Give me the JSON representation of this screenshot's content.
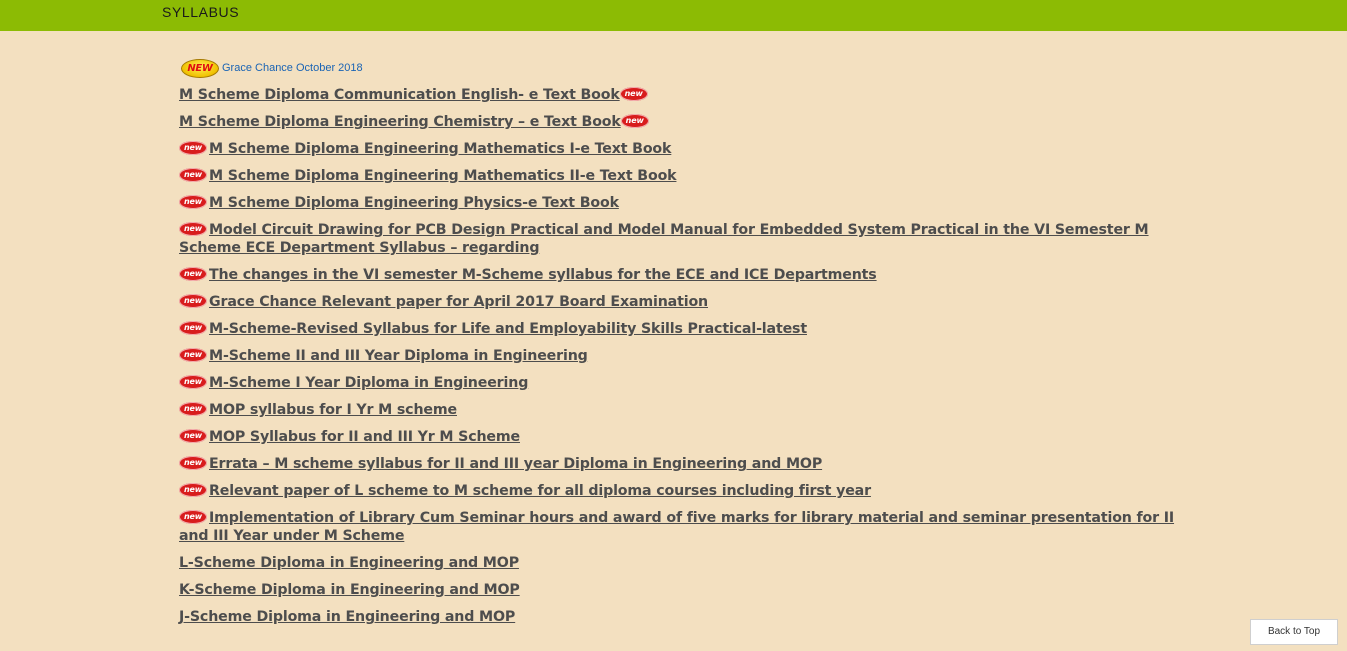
{
  "header": {
    "title": "SYLLABUS"
  },
  "grace": {
    "badge": "NEW",
    "label": "Grace Chance October 2018"
  },
  "badge_text": "new",
  "items": [
    {
      "label": "M Scheme Diploma Communication English- e Text Book",
      "badge": "after"
    },
    {
      "label": "M Scheme Diploma Engineering Chemistry – e Text Book",
      "badge": "after"
    },
    {
      "label": "M Scheme Diploma Engineering Mathematics I-e Text Book",
      "badge": "before"
    },
    {
      "label": "M Scheme Diploma Engineering Mathematics II-e Text Book",
      "badge": "before"
    },
    {
      "label": "M Scheme Diploma Engineering Physics-e Text Book",
      "badge": "before"
    },
    {
      "label": "Model Circuit Drawing for PCB Design Practical and Model Manual for Embedded System Practical in the VI Semester M Scheme ECE Department Syllabus – regarding",
      "badge": "before"
    },
    {
      "label": "The changes in the VI semester M-Scheme syllabus for the ECE and ICE Departments",
      "badge": "before"
    },
    {
      "label": "Grace Chance Relevant paper for April 2017 Board Examination",
      "badge": "before"
    },
    {
      "label": "M-Scheme-Revised Syllabus for Life and Employability Skills Practical-latest",
      "badge": "before"
    },
    {
      "label": "M-Scheme II and III Year Diploma in Engineering",
      "badge": "before"
    },
    {
      "label": "M-Scheme I Year Diploma in Engineering",
      "badge": "before"
    },
    {
      "label": "MOP syllabus for I Yr M scheme",
      "badge": "before"
    },
    {
      "label": "MOP Syllabus for II and III Yr M Scheme",
      "badge": "before"
    },
    {
      "label": "Errata – M scheme syllabus for II and III year Diploma in Engineering and MOP",
      "badge": "before"
    },
    {
      "label": "Relevant paper of L scheme to M scheme for all diploma courses including first year",
      "badge": "before"
    },
    {
      "label": "Implementation of Library Cum Seminar hours and award of five marks for library material and seminar presentation for II and III Year under M Scheme",
      "badge": "before"
    },
    {
      "label": "L-Scheme Diploma in Engineering and MOP",
      "badge": "none"
    },
    {
      "label": "K-Scheme Diploma in Engineering and MOP",
      "badge": "none"
    },
    {
      "label": "J-Scheme Diploma in Engineering and MOP",
      "badge": "none"
    }
  ],
  "back_to_top": "Back to Top",
  "colors": {
    "topbar": "#8cbb04",
    "background": "#f3e0c0",
    "link": "#4d4d4d",
    "grace_link": "#1a64b4",
    "badge": "#d81c1c"
  }
}
